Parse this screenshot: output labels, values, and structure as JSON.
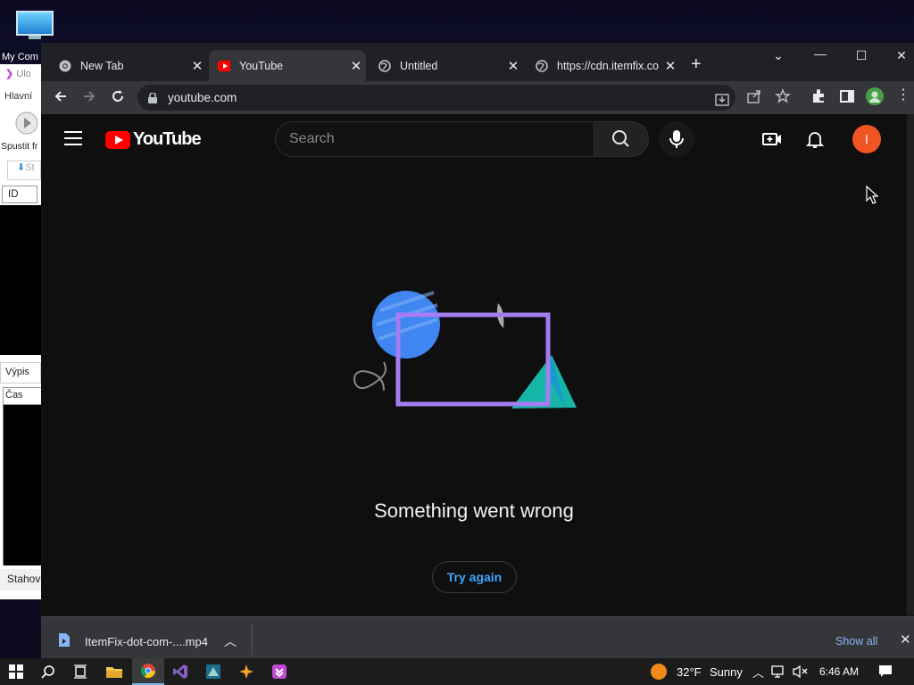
{
  "desktop": {
    "icon_label": "My Com"
  },
  "bg_app": {
    "title": "Ulo",
    "menu": "Hlavní",
    "run_label": "Spustit fr",
    "tab_label": "St",
    "id_header": "ID",
    "output_tab": "Výpis",
    "time_header": "Čas",
    "download_label": "Stahov"
  },
  "browser": {
    "tabs": [
      {
        "title": "New Tab",
        "active": false
      },
      {
        "title": "YouTube",
        "active": true
      },
      {
        "title": "Untitled",
        "active": false
      },
      {
        "title": "https://cdn.itemfix.co",
        "active": false
      }
    ],
    "url": "youtube.com"
  },
  "youtube": {
    "logo_text": "YouTube",
    "search_placeholder": "Search",
    "avatar_letter": "I",
    "error_title": "Something went wrong",
    "try_again": "Try again"
  },
  "downloads": {
    "file_name": "ItemFix-dot-com-....mp4",
    "show_all": "Show all"
  },
  "taskbar": {
    "weather_temp": "32°F",
    "weather_text": "Sunny",
    "time": "6:46 AM"
  },
  "colors": {
    "youtube_red": "#ff0000",
    "link_blue": "#3ea6ff",
    "avatar_orange": "#ef5522",
    "illus_purple": "#a57cf2",
    "illus_blue": "#3f86f0",
    "illus_teal": "#15b6a8"
  }
}
